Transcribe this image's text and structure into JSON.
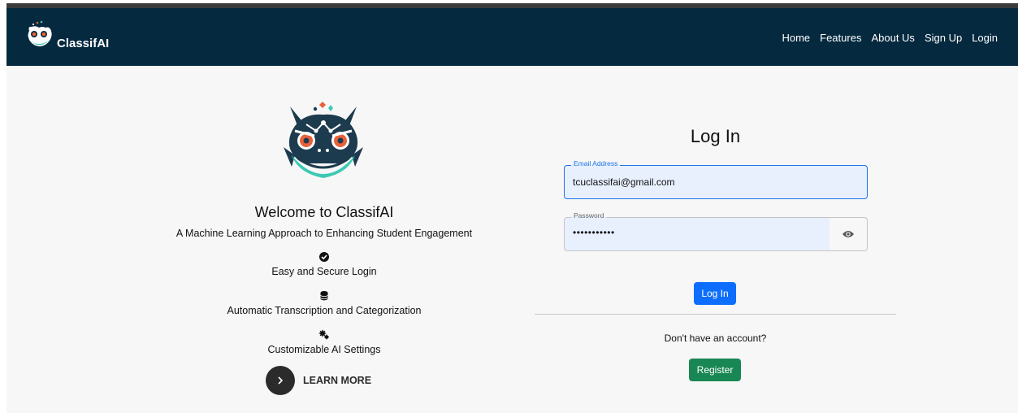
{
  "brand": {
    "name": "ClassifAI"
  },
  "nav": {
    "links": [
      "Home",
      "Features",
      "About Us",
      "Sign Up",
      "Login"
    ]
  },
  "hero": {
    "welcome": "Welcome to ClassifAI",
    "tagline": "A Machine Learning Approach to Enhancing Student Engagement",
    "features": [
      {
        "icon": "check-circle-icon",
        "label": "Easy and Secure Login"
      },
      {
        "icon": "database-icon",
        "label": "Automatic Transcription and Categorization"
      },
      {
        "icon": "gears-icon",
        "label": "Customizable AI Settings"
      }
    ],
    "learn_more": "LEARN MORE"
  },
  "login": {
    "title": "Log In",
    "email": {
      "label": "Email Address",
      "value": "tcuclassifai@gmail.com"
    },
    "password": {
      "label": "Password",
      "value": "•••••••••••"
    },
    "submit": "Log In",
    "no_account": "Don't have an account?",
    "register": "Register"
  },
  "colors": {
    "navbar": "#05293f",
    "primary": "#0d6efd",
    "success": "#198754",
    "logo_teal": "#3cc9b4",
    "logo_dark": "#1d3b4f",
    "logo_orange": "#e8613a"
  }
}
